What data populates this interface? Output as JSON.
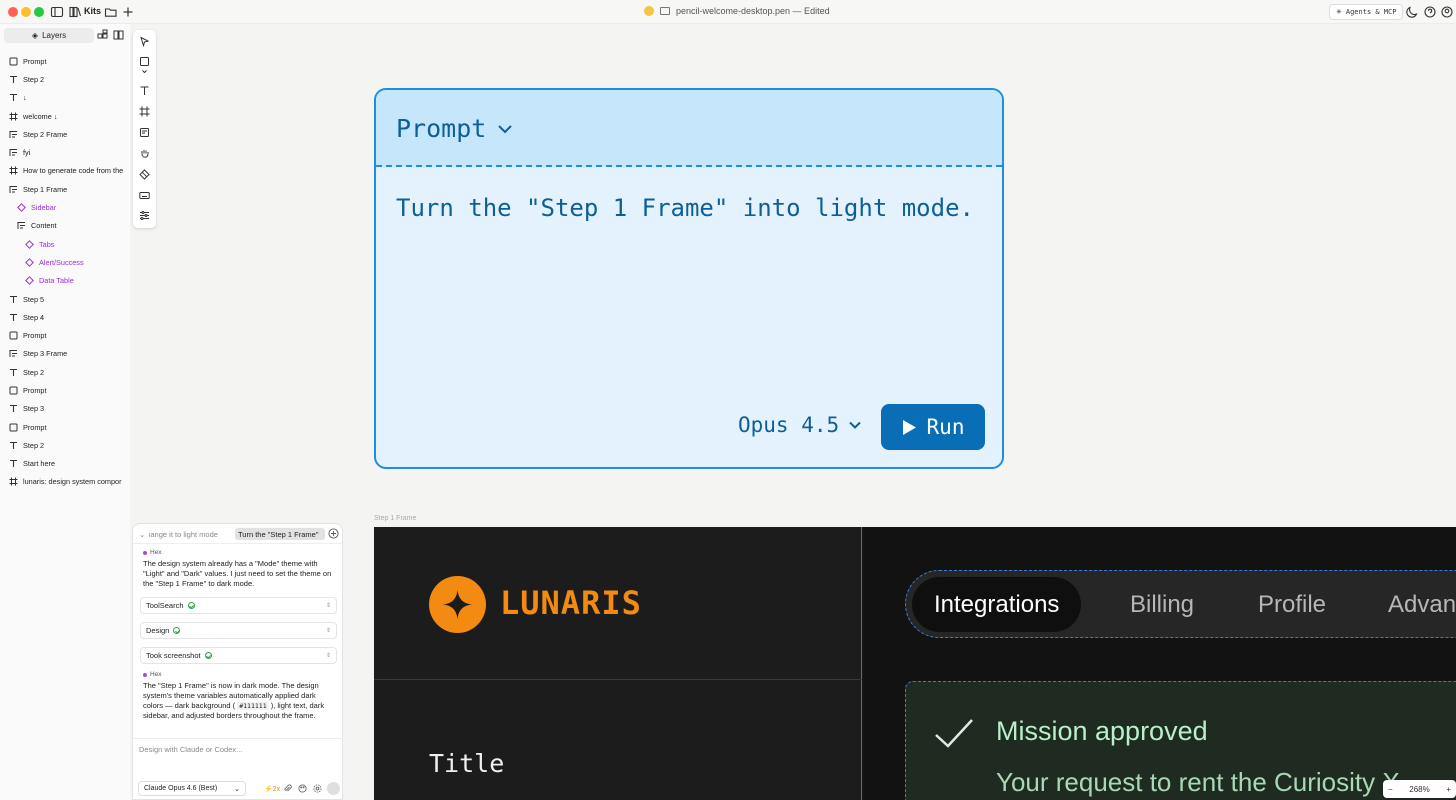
{
  "titlebar": {
    "workspace": "Kits",
    "document": "pencil-welcome-desktop.pen — Edited",
    "agents_button": "Agents & MCP"
  },
  "layers_panel": {
    "header": "Layers",
    "items": [
      {
        "label": "Prompt",
        "icon": "rectangle-icon",
        "indent": 0,
        "component": false
      },
      {
        "label": "Step 2",
        "icon": "text-icon",
        "indent": 0,
        "component": false
      },
      {
        "label": "↓",
        "icon": "text-icon",
        "indent": 0,
        "component": false
      },
      {
        "label": "welcome ↓",
        "icon": "frame-icon",
        "indent": 0,
        "component": false
      },
      {
        "label": "Step 2 Frame",
        "icon": "frame-layout-icon",
        "indent": 0,
        "component": false
      },
      {
        "label": "fyi",
        "icon": "frame-layout-icon",
        "indent": 0,
        "component": false
      },
      {
        "label": "How to generate code from the",
        "icon": "frame-icon",
        "indent": 0,
        "component": false
      },
      {
        "label": "Step 1 Frame",
        "icon": "frame-layout-icon",
        "indent": 0,
        "component": false
      },
      {
        "label": "Sidebar",
        "icon": "component-icon",
        "indent": 1,
        "component": true
      },
      {
        "label": "Content",
        "icon": "frame-layout-icon",
        "indent": 1,
        "component": false
      },
      {
        "label": "Tabs",
        "icon": "component-icon",
        "indent": 2,
        "component": true
      },
      {
        "label": "Alert/Success",
        "icon": "component-icon",
        "indent": 2,
        "component": true
      },
      {
        "label": "Data Table",
        "icon": "component-icon",
        "indent": 2,
        "component": true
      },
      {
        "label": "Step 5",
        "icon": "text-icon",
        "indent": 0,
        "component": false
      },
      {
        "label": "Step 4",
        "icon": "text-icon",
        "indent": 0,
        "component": false
      },
      {
        "label": "Prompt",
        "icon": "rectangle-icon",
        "indent": 0,
        "component": false
      },
      {
        "label": "Step 3 Frame",
        "icon": "frame-layout-icon",
        "indent": 0,
        "component": false
      },
      {
        "label": "Step 2",
        "icon": "text-icon",
        "indent": 0,
        "component": false
      },
      {
        "label": "Prompt",
        "icon": "rectangle-icon",
        "indent": 0,
        "component": false
      },
      {
        "label": "Step 3",
        "icon": "text-icon",
        "indent": 0,
        "component": false
      },
      {
        "label": "Prompt",
        "icon": "rectangle-icon",
        "indent": 0,
        "component": false
      },
      {
        "label": "Step 2",
        "icon": "text-icon",
        "indent": 0,
        "component": false
      },
      {
        "label": "Start here",
        "icon": "text-icon",
        "indent": 0,
        "component": false
      },
      {
        "label": "lunaris: design system compor",
        "icon": "frame-icon",
        "indent": 0,
        "component": false
      }
    ]
  },
  "prompt_card": {
    "title": "Prompt",
    "text": "Turn the \"Step 1 Frame\" into light mode.",
    "model": "Opus 4.5",
    "run_label": "Run",
    "accent": "#1e8fe0"
  },
  "canvas": {
    "frame_label": "Step 1 Frame",
    "zoom": "268%"
  },
  "step1_frame": {
    "brand": "LUNARIS",
    "brand_color": "#f38a12",
    "sidebar_title": "Title",
    "tabs": [
      "Integrations",
      "Billing",
      "Profile",
      "Advan"
    ],
    "active_tab": "Integrations",
    "alert_title": "Mission approved",
    "alert_body": "Your request to rent the Curiosity X"
  },
  "chat": {
    "tab_inactive": "ıange it to light mode",
    "tab_active": "Turn the \"Step 1 Frame\"",
    "author": "Hex",
    "message1": "The design system already has a \"Mode\" theme with \"Light\" and \"Dark\" values. I just need to set the theme on the \"Step 1 Frame\" to dark mode.",
    "tools": [
      "ToolSearch",
      "Design",
      "Took screenshot"
    ],
    "message2_a": "The \"Step 1 Frame\" is now in dark mode. The design system's theme variables automatically applied dark colors — dark background (",
    "message2_code": "#111111",
    "message2_b": "), light text, dark sidebar, and adjusted borders throughout the frame.",
    "input_placeholder": "Design with Claude or Codex...",
    "model": "Claude Opus 4.6 (Best)",
    "boost": "2x"
  }
}
